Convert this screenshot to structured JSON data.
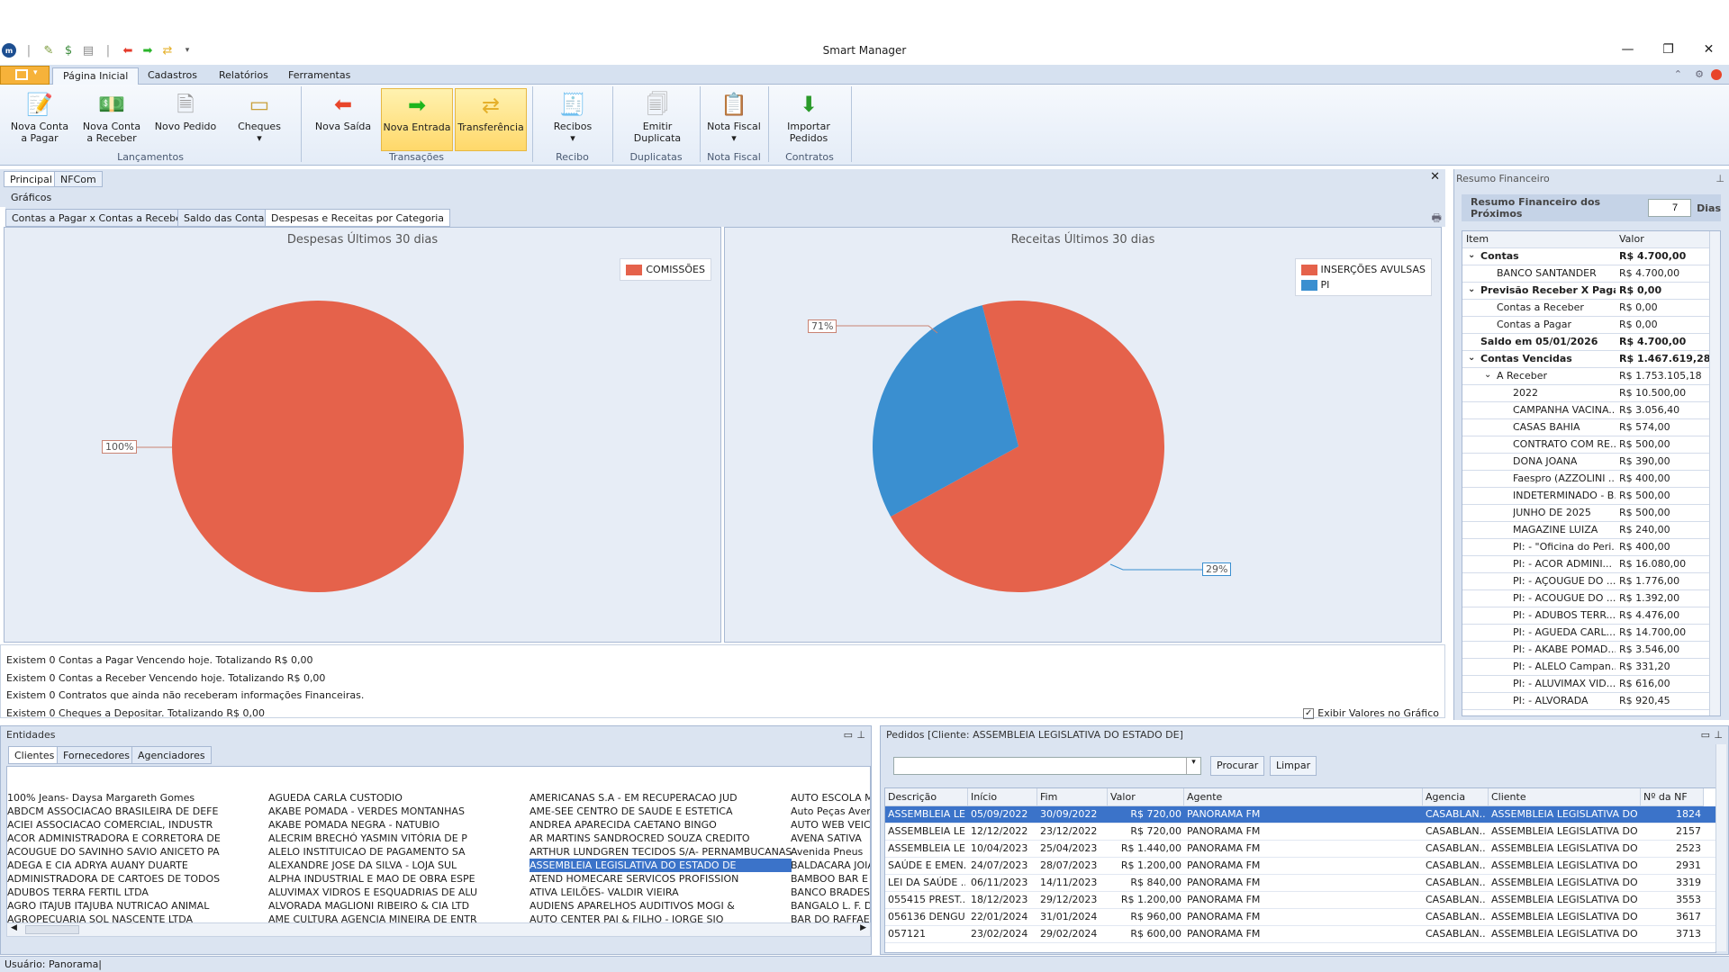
{
  "app": {
    "title": "Smart Manager"
  },
  "ribbon_tabs": [
    "Página Inicial",
    "Cadastros",
    "Relatórios",
    "Ferramentas"
  ],
  "ribbon": {
    "buttons": [
      {
        "l1": "Nova Conta",
        "l2": "a Pagar"
      },
      {
        "l1": "Nova Conta",
        "l2": "a Receber"
      },
      {
        "l1": "Novo Pedido",
        "l2": ""
      },
      {
        "l1": "Cheques",
        "l2": "▾"
      },
      {
        "l1": "Nova Saída",
        "l2": ""
      },
      {
        "l1": "Nova Entrada",
        "l2": ""
      },
      {
        "l1": "Transferência",
        "l2": ""
      },
      {
        "l1": "Recibos",
        "l2": "▾"
      },
      {
        "l1": "Emitir",
        "l2": "Duplicata"
      },
      {
        "l1": "Nota Fiscal",
        "l2": "▾"
      },
      {
        "l1": "Importar",
        "l2": "Pedidos"
      }
    ],
    "groups": [
      "Lançamentos",
      "Transações",
      "Recibo",
      "Duplicatas",
      "Nota Fiscal",
      "Contratos"
    ]
  },
  "doc_tabs": [
    "Principal",
    "NFCom"
  ],
  "section_label": "Gráficos",
  "chart_tabs": [
    "Contas a Pagar x Contas a Receber",
    "Saldo das Contas",
    "Despesas e Receitas por Categoria"
  ],
  "chart_data": [
    {
      "type": "pie",
      "title": "Despesas Últimos 30 dias",
      "categories": [
        "COMISSÕES"
      ],
      "values": [
        100
      ],
      "labels": [
        "100%"
      ],
      "colors": [
        "#e5624b"
      ],
      "legend_position": "top-right"
    },
    {
      "type": "pie",
      "title": "Receitas Últimos 30 dias",
      "categories": [
        "INSERÇÕES AVULSAS",
        "PI"
      ],
      "values": [
        71,
        29
      ],
      "labels": [
        "71%",
        "29%"
      ],
      "colors": [
        "#e5624b",
        "#3a8fd0"
      ],
      "legend_position": "top-right"
    }
  ],
  "alerts": [
    "Existem 0 Contas a Pagar Vencendo hoje. Totalizando R$ 0,00",
    "Existem 0 Contas a Receber Vencendo hoje. Totalizando R$ 0,00",
    "Existem 0 Contratos que ainda não receberam informações Financeiras.",
    "Existem 0 Cheques a Depositar. Totalizando R$ 0,00"
  ],
  "exibir_label": "Exibir Valores no Gráfico",
  "resumo": {
    "header": "Resumo Financeiro",
    "label": "Resumo Financeiro dos Próximos",
    "days": "7",
    "days_unit": "Dias",
    "col_item": "Item",
    "col_valor": "Valor",
    "rows": [
      {
        "item": "Contas",
        "valor": "R$ 4.700,00",
        "level": 0,
        "bold": true,
        "exp": true
      },
      {
        "item": "BANCO SANTANDER",
        "valor": "R$ 4.700,00",
        "level": 1
      },
      {
        "item": "Previsão Receber X Pagar",
        "valor": "R$ 0,00",
        "level": 0,
        "bold": true,
        "exp": true
      },
      {
        "item": "Contas a Receber",
        "valor": "R$ 0,00",
        "level": 1
      },
      {
        "item": "Contas a Pagar",
        "valor": "R$ 0,00",
        "level": 1
      },
      {
        "item": "Saldo em 05/01/2026",
        "valor": "R$ 4.700,00",
        "level": 0,
        "bold": true
      },
      {
        "item": "Contas Vencidas",
        "valor": "R$ 1.467.619,28",
        "level": 0,
        "bold": true,
        "exp": true
      },
      {
        "item": "A Receber",
        "valor": "R$ 1.753.105,18",
        "level": 1,
        "exp": true
      },
      {
        "item": "2022",
        "valor": "R$ 10.500,00",
        "level": 2
      },
      {
        "item": "CAMPANHA VACINA...",
        "valor": "R$ 3.056,40",
        "level": 2
      },
      {
        "item": "CASAS BAHIA",
        "valor": "R$ 574,00",
        "level": 2
      },
      {
        "item": "CONTRATO COM RE...",
        "valor": "R$ 500,00",
        "level": 2
      },
      {
        "item": "DONA JOANA",
        "valor": "R$ 390,00",
        "level": 2
      },
      {
        "item": "Faespro (AZZOLINI ...",
        "valor": "R$ 400,00",
        "level": 2
      },
      {
        "item": "INDETERMINADO - B...",
        "valor": "R$ 500,00",
        "level": 2
      },
      {
        "item": "JUNHO DE 2025",
        "valor": "R$ 500,00",
        "level": 2
      },
      {
        "item": "MAGAZINE LUIZA",
        "valor": "R$ 240,00",
        "level": 2
      },
      {
        "item": "PI:  - \"Oficina do Peri...",
        "valor": "R$ 400,00",
        "level": 2
      },
      {
        "item": "PI:  - ACOR ADMINI...",
        "valor": "R$ 16.080,00",
        "level": 2
      },
      {
        "item": "PI:  - AÇOUGUE DO ...",
        "valor": "R$ 1.776,00",
        "level": 2
      },
      {
        "item": "PI:  - ACOUGUE DO ...",
        "valor": "R$ 1.392,00",
        "level": 2
      },
      {
        "item": "PI:  - ADUBOS TERR...",
        "valor": "R$ 4.476,00",
        "level": 2
      },
      {
        "item": "PI:  - AGUEDA CARL...",
        "valor": "R$ 14.700,00",
        "level": 2
      },
      {
        "item": "PI:  - AKABE POMAD...",
        "valor": "R$ 3.546,00",
        "level": 2
      },
      {
        "item": "PI:  - ALELO Campan...",
        "valor": "R$ 331,20",
        "level": 2
      },
      {
        "item": "PI:  - ALUVIMAX VID...",
        "valor": "R$ 616,00",
        "level": 2
      },
      {
        "item": "PI:  - ALVORADA",
        "valor": "R$ 920,45",
        "level": 2
      }
    ]
  },
  "entidades": {
    "header": "Entidades",
    "tabs": [
      "Clientes",
      "Fornecedores",
      "Agenciadores"
    ],
    "columns": [
      [
        "100%  Jeans- Daysa Margareth Gomes",
        "ABDCM ASSOCIACAO BRASILEIRA DE DEFE",
        "ACIEI ASSOCIACAO COMERCIAL, INDUSTR",
        "ACOR ADMINISTRADORA E CORRETORA DE",
        "ACOUGUE DO SAVINHO SAVIO ANICETO PA",
        "ADEGA E CIA ADRYA AUANY DUARTE",
        "ADMINISTRADORA DE CARTOES DE TODOS",
        "ADUBOS TERRA FERTIL LTDA",
        "AGRO ITAJUB ITAJUBA NUTRICAO ANIMAL",
        "AGROPECUARIA SOL NASCENTE LTDA"
      ],
      [
        "AGUEDA CARLA CUSTODIO",
        "AKABE POMADA - VERDES MONTANHAS",
        "AKABE POMADA NEGRA - NATUBIO",
        "ALECRIM BRECHÓ YASMIN VITÓRIA DE P",
        "ALELO INSTITUICAO DE PAGAMENTO SA",
        "ALEXANDRE JOSE DA SILVA - LOJA SUL",
        "ALPHA INDUSTRIAL E MAO DE OBRA ESPE",
        "ALUVIMAX VIDROS E ESQUADRIAS DE ALU",
        "ALVORADA MAGLIONI RIBEIRO & CIA LTD",
        "AME CULTURA AGENCIA MINEIRA DE ENTR"
      ],
      [
        "AMERICANAS S.A - EM RECUPERACAO JUD",
        "AME-SEE CENTRO DE SAUDE E ESTETICA",
        "ANDREA APARECIDA CAETANO BINGO",
        "AR MARTINS SANDROCRED SOUZA CREDITO",
        "ARTHUR LUNDGREN TECIDOS S/A- PERNAMBUCANAS",
        "ASSEMBLEIA LEGISLATIVA DO ESTADO DE",
        "ATEND HOMECARE  SERVICOS PROFISSION",
        "ATIVA LEILÕES- VALDIR VIEIRA",
        "AUDIENS APARELHOS AUDITIVOS MOGI &",
        "AUTO CENTER PAI & FILHO - JORGE SIQ"
      ],
      [
        "AUTO ESCOLA MG",
        "Auto Peças Avenida",
        "AUTO WEB VEICULOS",
        "AVENA SATIVA",
        "Avenida Pneus",
        "BALDACARA JOIAS",
        "BAMBOO BAR E RE",
        "BANCO BRADESCO",
        "BANGALO L. F. DE",
        "BAR DO RAFFAEL"
      ]
    ],
    "selected": "ASSEMBLEIA LEGISLATIVA DO ESTADO DE"
  },
  "pedidos": {
    "header": "Pedidos [Cliente: ASSEMBLEIA LEGISLATIVA DO ESTADO DE]",
    "search_value": "",
    "btn_procurar": "Procurar",
    "btn_limpar": "Limpar",
    "columns": [
      "Descrição",
      "Início",
      "Fim",
      "Valor",
      "Agente",
      "Agencia",
      "Cliente",
      "Nº da NF"
    ],
    "rows": [
      [
        "ASSEMBLEIA LE...",
        "05/09/2022",
        "30/09/2022",
        "R$ 720,00",
        "PANORAMA FM",
        "CASABLAN...",
        "ASSEMBLEIA LEGISLATIVA DO ...",
        "1824"
      ],
      [
        "ASSEMBLEIA LE...",
        "12/12/2022",
        "23/12/2022",
        "R$ 720,00",
        "PANORAMA FM",
        "CASABLAN...",
        "ASSEMBLEIA LEGISLATIVA DO ...",
        "2157"
      ],
      [
        "ASSEMBLEIA LE...",
        "10/04/2023",
        "25/04/2023",
        "R$ 1.440,00",
        "PANORAMA FM",
        "CASABLAN...",
        "ASSEMBLEIA LEGISLATIVA DO ...",
        "2523"
      ],
      [
        "SAÚDE E EMEN...",
        "24/07/2023",
        "28/07/2023",
        "R$ 1.200,00",
        "PANORAMA FM",
        "CASABLAN...",
        "ASSEMBLEIA LEGISLATIVA DO ...",
        "2931"
      ],
      [
        "LEI DA SAÚDE ...",
        "06/11/2023",
        "14/11/2023",
        "R$ 840,00",
        "PANORAMA FM",
        "CASABLAN...",
        "ASSEMBLEIA LEGISLATIVA DO ...",
        "3319"
      ],
      [
        "055415 PREST...",
        "18/12/2023",
        "29/12/2023",
        "R$ 1.200,00",
        "PANORAMA FM",
        "CASABLAN...",
        "ASSEMBLEIA LEGISLATIVA DO ...",
        "3553"
      ],
      [
        "056136 DENGU...",
        "22/01/2024",
        "31/01/2024",
        "R$ 960,00",
        "PANORAMA FM",
        "CASABLAN...",
        "ASSEMBLEIA LEGISLATIVA DO ...",
        "3617"
      ],
      [
        "057121",
        "23/02/2024",
        "29/02/2024",
        "R$ 600,00",
        "PANORAMA FM",
        "CASABLAN...",
        "ASSEMBLEIA LEGISLATIVA DO ...",
        "3713"
      ]
    ]
  },
  "status": {
    "user": "Usuário: Panorama|"
  }
}
